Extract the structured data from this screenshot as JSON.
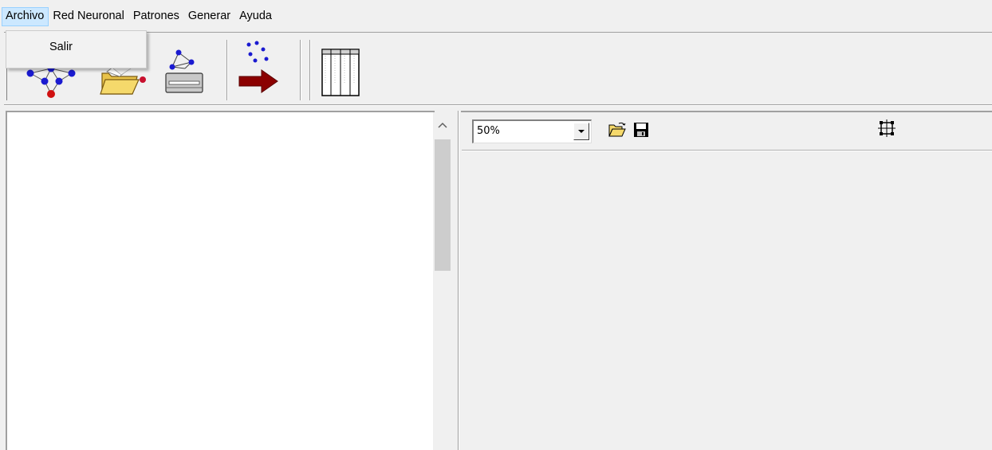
{
  "menubar": {
    "items": [
      {
        "label": "Archivo",
        "active": true
      },
      {
        "label": "Red Neuronal",
        "active": false
      },
      {
        "label": "Patrones",
        "active": false
      },
      {
        "label": "Generar",
        "active": false
      },
      {
        "label": "Ayuda",
        "active": false
      }
    ]
  },
  "archivo_menu": {
    "items": [
      {
        "label": "Salir"
      }
    ]
  },
  "toolbar": {
    "buttons": [
      {
        "icon": "neural-network-icon"
      },
      {
        "icon": "open-folder-icon"
      },
      {
        "icon": "network-printer-icon"
      },
      {
        "icon": "generate-patterns-icon"
      },
      {
        "icon": "grid-panel-icon"
      }
    ]
  },
  "viewer": {
    "zoom_value": "50%",
    "zoom_options": [
      "50%"
    ],
    "buttons": [
      {
        "icon": "open-file-icon"
      },
      {
        "icon": "save-icon"
      },
      {
        "icon": "fit-view-icon"
      }
    ]
  },
  "colors": {
    "menu_highlight": "#cce8ff",
    "menu_highlight_border": "#99d1ff",
    "window_bg": "#f0f0f0",
    "pane_bg": "#ffffff",
    "network_node_blue": "#1a1ad0",
    "network_node_red": "#d01010",
    "arrow_red": "#8b0000",
    "folder_yellow": "#f5d96b"
  }
}
